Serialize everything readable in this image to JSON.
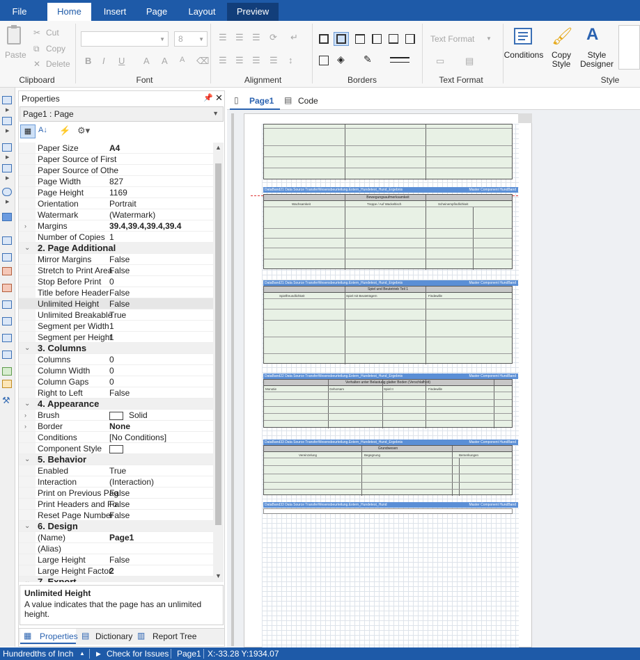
{
  "menu": {
    "file": "File",
    "tabs": [
      "Home",
      "Insert",
      "Page",
      "Layout",
      "Preview"
    ]
  },
  "ribbon": {
    "clipboard": {
      "paste": "Paste",
      "cut": "Cut",
      "copy": "Copy",
      "delete": "Delete",
      "label": "Clipboard"
    },
    "font": {
      "size": "8",
      "label": "Font"
    },
    "alignment": {
      "label": "Alignment"
    },
    "borders": {
      "label": "Borders"
    },
    "text_format": {
      "button": "Text Format",
      "label": "Text Format"
    },
    "style": {
      "conditions": "Conditions",
      "copy_style": "Copy\nStyle",
      "style_designer": "Style\nDesigner",
      "label": "Style"
    }
  },
  "properties": {
    "title": "Properties",
    "selector": "Page1 : Page",
    "rows": [
      {
        "name": "Paper Size",
        "value": "A4",
        "bold": true
      },
      {
        "name": "Paper Source of First",
        "value": ""
      },
      {
        "name": "Paper Source of Othe",
        "value": ""
      },
      {
        "name": "Page Width",
        "value": "827"
      },
      {
        "name": "Page Height",
        "value": "1169"
      },
      {
        "name": "Orientation",
        "value": "Portrait"
      },
      {
        "name": "Watermark",
        "value": "(Watermark)"
      },
      {
        "name": "Margins",
        "value": "39.4,39.4,39.4,39.4",
        "bold": true,
        "expand": true
      },
      {
        "name": "Number of Copies",
        "value": "1"
      },
      {
        "name": "2. Page  Additional",
        "cat": true
      },
      {
        "name": "Mirror Margins",
        "value": "False"
      },
      {
        "name": "Stretch to Print Area",
        "value": "False"
      },
      {
        "name": "Stop Before Print",
        "value": "0"
      },
      {
        "name": "Title before Header",
        "value": "False"
      },
      {
        "name": "Unlimited Height",
        "value": "False",
        "selected": true
      },
      {
        "name": "Unlimited Breakable",
        "value": "True"
      },
      {
        "name": "Segment per Width",
        "value": "1"
      },
      {
        "name": "Segment per Height",
        "value": "1"
      },
      {
        "name": "3. Columns",
        "cat": true
      },
      {
        "name": "Columns",
        "value": "0"
      },
      {
        "name": "Column Width",
        "value": "0"
      },
      {
        "name": "Column Gaps",
        "value": "0"
      },
      {
        "name": "Right to Left",
        "value": "False"
      },
      {
        "name": "4. Appearance",
        "cat": true
      },
      {
        "name": "Brush",
        "value": "Solid",
        "expand": true,
        "swatch": true
      },
      {
        "name": "Border",
        "value": "None",
        "bold": true,
        "expand": true
      },
      {
        "name": "Conditions",
        "value": "[No Conditions]"
      },
      {
        "name": "Component Style",
        "value": "",
        "swatch": true
      },
      {
        "name": "5. Behavior",
        "cat": true
      },
      {
        "name": "Enabled",
        "value": "True"
      },
      {
        "name": "Interaction",
        "value": "(Interaction)"
      },
      {
        "name": "Print on Previous Pag",
        "value": "False"
      },
      {
        "name": "Print Headers and Fo",
        "value": "False"
      },
      {
        "name": "Reset Page Number",
        "value": "False"
      },
      {
        "name": "6. Design",
        "cat": true
      },
      {
        "name": "(Name)",
        "value": "Page1",
        "bold": true
      },
      {
        "name": "(Alias)",
        "value": ""
      },
      {
        "name": "Large Height",
        "value": "False"
      },
      {
        "name": "Large Height Factor",
        "value": "2",
        "bold": true
      },
      {
        "name": "7. Export",
        "cat": true
      }
    ],
    "desc_title": "Unlimited Height",
    "desc_text": "A value indicates that the page has an unlimited height.",
    "tabs": [
      "Properties",
      "Dictionary",
      "Report Tree"
    ]
  },
  "doc_tabs": {
    "page": "Page1",
    "code": "Code"
  },
  "bands": [
    {
      "left": "DataBand21  Data  Source  TransferWesensbeurteilung.Extern_Hundetest_Hund_Ergebnis",
      "right": "Master  Component  HundBand"
    },
    {
      "left": "DataBand21  Data  Source  TransferWesensbeurteilung.Extern_Hundetest_Hund_Ergebnis",
      "right": "Master  Component  HundBand"
    },
    {
      "left": "DataBand22  Data  Source  TransferWesensbeurteilung.Extern_Hundetest_Hund_Ergebnis",
      "right": "Master  Component  HundBand"
    },
    {
      "left": "DataBand33  Data  Source  TransferWesensbeurteilung.Extern_Hundetest_Hund_Ergebnis",
      "right": "Master  Component  HundBand"
    },
    {
      "left": "DataBand33  Data  Source  TransferWesensbeurteilung.Extern_Hundetest_Hund",
      "right": "Master  Component  HundBand"
    }
  ],
  "tables": {
    "t1": {
      "title": "Bewegungsaufmerksamkeit",
      "cols": [
        "Wachsamkeit",
        "Treppe / Auf Wackeltisch",
        "Scheinempfindlichkeit"
      ]
    },
    "t2": {
      "title": "Spiel und Beutetrieb Teil 1",
      "cols": [
        "Spielfreundlichkeit",
        "Spiel mit Beuteträgern",
        "Findewille"
      ]
    },
    "t3": {
      "title": "Verhalten unter Belastung  glatter Boden (Verschlafheit)",
      "cols": [
        "Monotie",
        "Gehorsam",
        "Spiel II",
        "Findewille"
      ]
    },
    "t4": {
      "title": "Grundwesen",
      "cols": [
        "Vereinzelung",
        "Begegnung",
        "Bemerkungen"
      ]
    }
  },
  "status": {
    "units": "Hundredths of Inch",
    "check": "Check for Issues",
    "page": "Page1",
    "coords": "X:-33.28 Y:1934.07"
  }
}
